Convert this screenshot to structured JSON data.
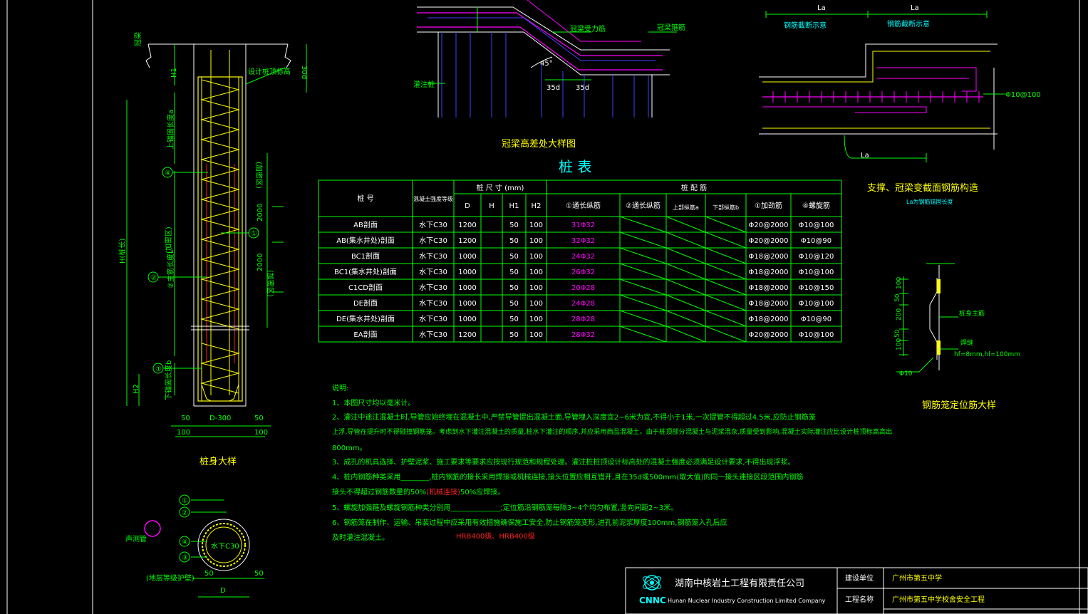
{
  "colors": {
    "background": "#000000",
    "green": "#00ff00",
    "yellow": "#ffff00",
    "magenta": "#ff00ff",
    "cyan": "#00ffff",
    "red": "#ff2020",
    "white": "#ffffff",
    "blue": "#4040ff"
  },
  "pile_detail": {
    "title": "桩身大样",
    "crown_beam": "冠梁",
    "design_top": "设计桩顶标高",
    "dim_30d": "30d",
    "dim_h1": "H1",
    "upper_anchor": "上锚固长度a",
    "total_h": "H(桩长)",
    "main_len": "②主筋长度L",
    "lower_anchor": "下锚固长度b",
    "dim_h2": "H2",
    "dense": "(加密区)",
    "dim_2000a": "2000",
    "dim_2000b": "2000",
    "dense2": "(加密区)",
    "d_label": "D-300",
    "dim_50": "50",
    "dim_100": "100",
    "tags": [
      "④",
      "①",
      "②",
      "①"
    ]
  },
  "section": {
    "concrete": "水下C30",
    "dense_label": "(地层等级护壁)",
    "d": "D",
    "dim_50": "50",
    "tags": [
      "①",
      "②",
      "④",
      "③"
    ],
    "sound_tube": "声测管"
  },
  "crown_detail": {
    "title": "冠梁高差处大样图",
    "label1": "冠梁受力筋",
    "label2": "冠梁箍筋",
    "label3": "灌注桩",
    "angle": "45°",
    "dim_35d_a": "35d",
    "dim_35d_b": "35d"
  },
  "support_detail": {
    "title": "支撑、冠梁变截面钢筋构造",
    "subtitle": "La为钢筋锚固长度",
    "la_top_a": "La",
    "la_top_b": "La",
    "label_a": "钢筋截断示意",
    "label_b": "钢筋截断示意",
    "la_bottom": "La",
    "rebar": "Φ10@100"
  },
  "spacer_detail": {
    "title": "钢筋笼定位筋大样",
    "label_main": "桩身主筋",
    "label_weld": "焊缝",
    "weld_spec": "hf=8mm,hl=100mm",
    "rebar": "Φ10",
    "dims": [
      "100",
      "50",
      "200",
      "50",
      "100"
    ]
  },
  "pile_table": {
    "title": "桩 表",
    "headers": {
      "no": "桩 号",
      "concrete": "混凝土强度等级",
      "size": "桩 尺 寸 (mm)",
      "rebar": "桩 配 筋",
      "d": "D",
      "h": "H",
      "h1": "H1",
      "h2": "H2",
      "r1": "①通长纵筋",
      "r2": "②通长纵筋",
      "r3": "上部纵筋a",
      "r4": "下部纵筋b",
      "r5": "①加劲筋",
      "r6": "④螺旋筋"
    },
    "rows": [
      {
        "no": "AB剖面",
        "c": "水下C30",
        "d": "1200",
        "h1": "50",
        "h2": "100",
        "main": "31Φ32",
        "stiff": "Φ20@2000",
        "spiral": "Φ10@100"
      },
      {
        "no": "AB(集水井处)剖面",
        "c": "水下C30",
        "d": "1200",
        "h1": "50",
        "h2": "100",
        "main": "32Φ32",
        "stiff": "Φ20@2000",
        "spiral": "Φ10@90"
      },
      {
        "no": "BC1剖面",
        "c": "水下C30",
        "d": "1000",
        "h1": "50",
        "h2": "100",
        "main": "24Φ32",
        "stiff": "Φ18@2000",
        "spiral": "Φ10@120"
      },
      {
        "no": "BC1(集水井处)剖面",
        "c": "水下C30",
        "d": "1000",
        "h1": "50",
        "h2": "100",
        "main": "26Φ32",
        "stiff": "Φ18@2000",
        "spiral": "Φ10@100"
      },
      {
        "no": "C1CD剖面",
        "c": "水下C30",
        "d": "1000",
        "h1": "50",
        "h2": "100",
        "main": "20Φ28",
        "stiff": "Φ18@2000",
        "spiral": "Φ10@150"
      },
      {
        "no": "DE剖面",
        "c": "水下C30",
        "d": "1000",
        "h1": "50",
        "h2": "100",
        "main": "24Φ28",
        "stiff": "Φ18@2000",
        "spiral": "Φ10@100"
      },
      {
        "no": "DE(集水井处)剖面",
        "c": "水下C30",
        "d": "1000",
        "h1": "50",
        "h2": "100",
        "main": "28Φ28",
        "stiff": "Φ18@2000",
        "spiral": "Φ10@90"
      },
      {
        "no": "EA剖面",
        "c": "水下C30",
        "d": "1200",
        "h1": "50",
        "h2": "100",
        "main": "28Φ32",
        "stiff": "Φ20@2000",
        "spiral": "Φ10@100"
      }
    ]
  },
  "notes": {
    "heading": "说明:",
    "l1": "1、本图尺寸均以毫米计。",
    "l2": "2、灌注中途注混凝土时,导管应始终埋在混凝土中,严禁导管提出混凝土面,导管埋入深度宜2~6米为宜,不得小于1米,一次提管不得超过4.5米,应防止钢筋笼",
    "l3": "上浮,导管在提升时不得碰撞钢筋笼。考虑到水下灌注混凝土的质量,桩水下灌注的顺序,并应采用商品混凝土。由于桩顶部分混凝土与泥浆混杂,质量受到影响,混凝土实际灌注应比设计桩顶标高高出",
    "l4": "800mm。",
    "l5": "3、成孔的机具选择、护壁泥浆、施工要求等要求应按现行规范和规程处理。灌注桩桩顶设计标高处的混凝土强度必须满足设计要求,不得出现浮浆。",
    "l6": "4、桩内钢筋种类采用________,桩内钢筋的接长采用焊接或机械连接,接头位置应相互错开,且在35d或500mm(取大值)的同一接头連接区段范围内钢筋",
    "l7a": "接头不得超过钢筋数量的50%",
    "l7b": "(机械连接)",
    "l7c": "50%应焊接。",
    "l8": "5、螺旋加强箍及螺旋钢筋种类分别用______________;定位筋沿钢筋笼每隔3~4个均匀布置,竖向间距2~3米。",
    "l9": "6、钢筋笼在制作、运输、吊装过程中应采用有效措施确保施工安全,防止钢筋笼变形,进孔前泥浆厚度100mm,钢筋笼入孔后应",
    "l10": "及时灌注混凝土。",
    "red_note": "HRB400级、HRB400级"
  },
  "title_block": {
    "company": "湖南中核岩土工程有限责任公司",
    "company_en": "Hunan Nuclear Industry Construction Limited Company",
    "logo_text": "CNNC",
    "label_owner": "建设单位",
    "owner": "广州市第五中学",
    "label_project": "工程名称",
    "project": "广州市第五中学校舍安全工程"
  }
}
